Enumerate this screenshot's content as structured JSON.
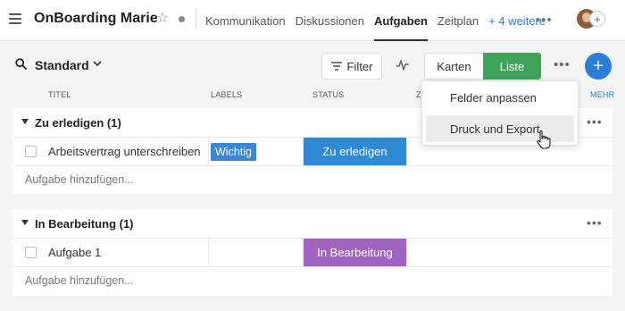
{
  "header": {
    "project_title": "OnBoarding Marie",
    "nav": [
      "Kommunikation",
      "Diskussionen",
      "Aufgaben",
      "Zeitplan",
      "+ 4 weitere"
    ],
    "active_tab": "Aufgaben",
    "more_dots": "•••",
    "add_member": "+"
  },
  "toolbar": {
    "view_name": "Standard",
    "view_chevron": "⌄",
    "filter_label": "Filter",
    "view_cards": "Karten",
    "view_list": "Liste",
    "more_dots": "•••",
    "add_label": "+"
  },
  "columns": {
    "title": "TITEL",
    "labels": "LABELS",
    "status": "STATUS",
    "partial": "Z",
    "more": "MEHR"
  },
  "groups": [
    {
      "title": "Zu erledigen (1)",
      "tasks": [
        {
          "name": "Arbeitsvertrag unterschreiben",
          "label": "Wichtig",
          "status": "Zu erledigen"
        }
      ],
      "add_task": "Aufgabe hinzufügen..."
    },
    {
      "title": "In Bearbeitung (1)",
      "tasks": [
        {
          "name": "Aufgabe 1",
          "label": "",
          "status": "In Bearbeitung"
        }
      ],
      "add_task": "Aufgabe hinzufügen..."
    }
  ],
  "menu": {
    "items": [
      "Felder anpassen",
      "Druck und Export"
    ],
    "hovered": "Druck und Export"
  },
  "colors": {
    "accent_blue": "#2a7ed8",
    "list_green": "#3ea45a",
    "label_blue": "#3a86d4",
    "status_todo": "#2f8ad6",
    "status_in_progress": "#a264c2"
  }
}
